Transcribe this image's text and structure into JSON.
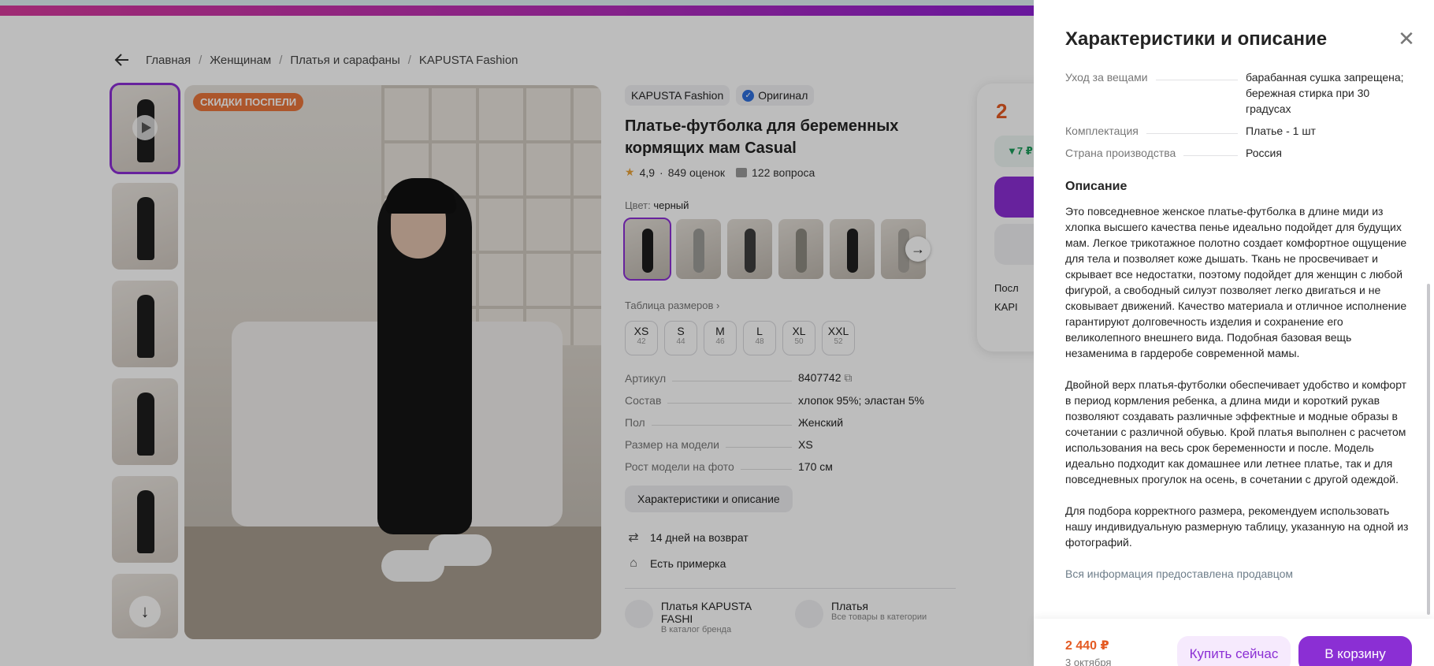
{
  "breadcrumbs": [
    "Главная",
    "Женщинам",
    "Платья и сарафаны",
    "KAPUSTA Fashion"
  ],
  "product": {
    "sale_badge": "СКИДКИ ПОСПЕЛИ",
    "brand": "KAPUSTA Fashion",
    "original": "Оригинал",
    "title": "Платье-футболка для беременных кормящих мам Casual",
    "rating": "4,9",
    "reviews": "849 оценок",
    "questions": "122 вопроса",
    "color_label": "Цвет:",
    "color_value": "черный",
    "size_table": "Таблица размеров ›",
    "sizes": [
      {
        "s": "XS",
        "n": "42"
      },
      {
        "s": "S",
        "n": "44"
      },
      {
        "s": "M",
        "n": "46"
      },
      {
        "s": "L",
        "n": "48"
      },
      {
        "s": "XL",
        "n": "50"
      },
      {
        "s": "XXL",
        "n": "52"
      }
    ],
    "specs": [
      {
        "k": "Артикул",
        "v": "8407742"
      },
      {
        "k": "Состав",
        "v": "хлопок 95%; эластан 5%"
      },
      {
        "k": "Пол",
        "v": "Женский"
      },
      {
        "k": "Размер на модели",
        "v": "XS"
      },
      {
        "k": "Рост модели на фото",
        "v": "170 см"
      }
    ],
    "desc_button": "Характеристики и описание",
    "features": [
      "14 дней на возврат",
      "Есть примерка"
    ],
    "links": [
      {
        "t1": "Платья KAPUSTA FASHI",
        "t2": "В каталог бренда"
      },
      {
        "t1": "Платья",
        "t2": "Все товары в категории"
      }
    ]
  },
  "price_card": {
    "price": "2",
    "wallet": "▼7 ₽",
    "line1": "Посл",
    "line2": "KAPI"
  },
  "panel": {
    "title": "Характеристики и описание",
    "specs": [
      {
        "k": "Уход за вещами",
        "v": "барабанная сушка запрещена; бережная стирка при 30 градусах"
      },
      {
        "k": "Комплектация",
        "v": "Платье - 1 шт"
      },
      {
        "k": "Страна производства",
        "v": "Россия"
      }
    ],
    "desc_title": "Описание",
    "desc": [
      "Это повседневное женское платье-футболка в длине миди из хлопка высшего качества пенье идеально подойдет для будущих мам. Легкое трикотажное полотно создает комфортное ощущение для тела и позволяет коже дышать. Ткань не просвечивает и скрывает все недостатки, поэтому подойдет для женщин с любой фигурой, а свободный силуэт позволяет легко двигаться и не сковывает движений. Качество материала и отличное исполнение гарантируют долговечность изделия и сохранение его великолепного внешнего вида. Подобная базовая вещь незаменима в гардеробе современной мамы.",
      "Двойной верх платья-футболки обеспечивает удобство и комфорт в период кормления ребенка, а длина миди и короткий рукав позволяют создавать различные эффектные и модные образы в сочетании с различной обувью. Крой платья выполнен с расчетом использования на весь срок беременности и после. Модель идеально подходит как домашнее или летнее платье, так и для повседневных прогулок на осень, в сочетании с другой одеждой.",
      "Для подбора корректного размера, рекомендуем использовать нашу индивидуальную размерную таблицу, указанную на одной из фотографий."
    ],
    "source": "Вся информация предоставлена продавцом",
    "footer": {
      "price": "2 440 ₽",
      "date": "3 октября",
      "buy_now": "Купить сейчас",
      "cart": "В корзину"
    }
  },
  "colors": {
    "accent": "#8b2fd4",
    "price": "#e45a22"
  }
}
